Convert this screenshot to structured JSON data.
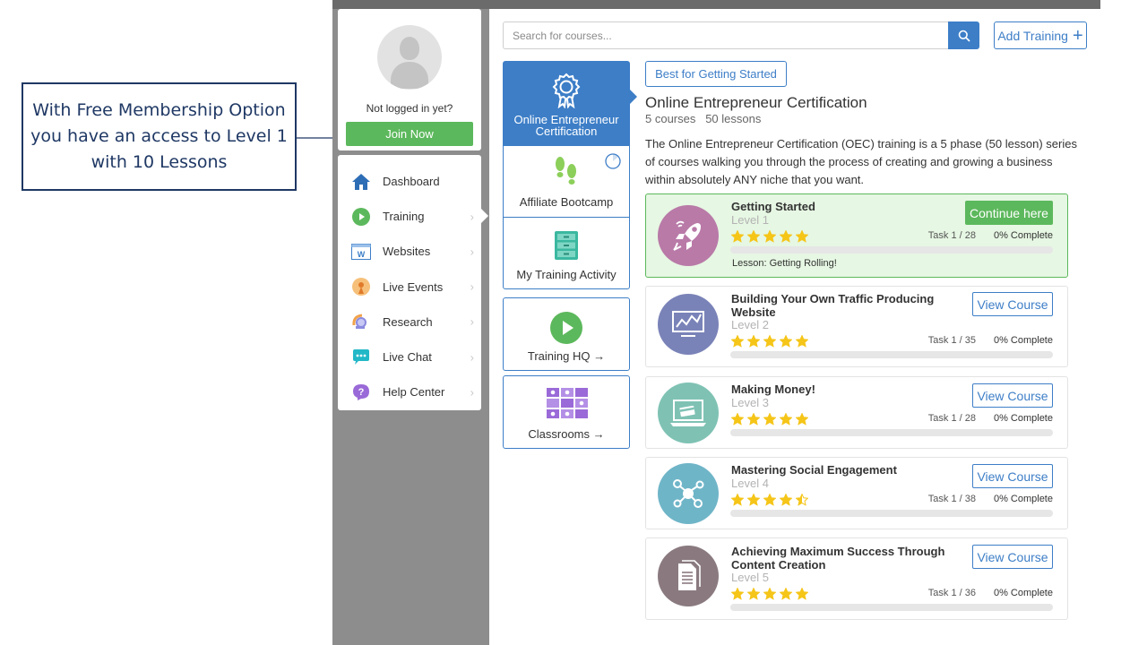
{
  "callout": {
    "text": "With Free Membership Option you have an access to Level 1 with 10 Lessons"
  },
  "sidebar": {
    "login_text": "Not logged in yet?",
    "join_label": "Join Now",
    "items": [
      {
        "label": "Dashboard",
        "icon": "home-icon",
        "color": "#2d6db5"
      },
      {
        "label": "Training",
        "icon": "play-circle-icon",
        "color": "#5cb85c"
      },
      {
        "label": "Websites",
        "icon": "website-icon",
        "color": "#3d7ec7"
      },
      {
        "label": "Live Events",
        "icon": "live-events-icon",
        "color": "#f0a24a"
      },
      {
        "label": "Research",
        "icon": "research-icon",
        "color": "#8a8ae0"
      },
      {
        "label": "Live Chat",
        "icon": "chat-icon",
        "color": "#23b8c8"
      },
      {
        "label": "Help Center",
        "icon": "help-icon",
        "color": "#9a6ad8"
      }
    ]
  },
  "search": {
    "placeholder": "Search for courses..."
  },
  "add_training": {
    "label": "Add Training"
  },
  "categories": [
    {
      "label": "Online Entrepreneur Certification",
      "icon": "certificate-icon"
    },
    {
      "label": "Affiliate Bootcamp",
      "icon": "footprints-icon"
    },
    {
      "label": "My Training Activity",
      "icon": "cabinet-icon"
    }
  ],
  "boxes": [
    {
      "label": "Training HQ →",
      "icon": "play-circle-icon"
    },
    {
      "label": "Classrooms →",
      "icon": "classrooms-icon"
    }
  ],
  "program": {
    "badge": "Best for Getting Started",
    "title": "Online Entrepreneur Certification",
    "meta": "5 courses   50 lessons",
    "description": "The Online Entrepreneur Certification (OEC) training is a 5 phase (50 lesson) series of courses walking you through the process of creating and growing a business within absolutely ANY niche that you want."
  },
  "courses": [
    {
      "title": "Getting Started",
      "level": "Level 1",
      "task": "Task 1 / 28",
      "percent": "0% Complete",
      "progress": 0,
      "rating": 5,
      "button": "Continue here",
      "lesson": "Lesson: Getting Rolling!",
      "icon": "rocket-icon",
      "color": "#b97aa8"
    },
    {
      "title": "Building Your Own Traffic Producing Website",
      "level": "Level 2",
      "task": "Task 1 / 35",
      "percent": "0% Complete",
      "progress": 0,
      "rating": 5,
      "button": "View Course",
      "icon": "chart-monitor-icon",
      "color": "#7a83b8"
    },
    {
      "title": "Making Money!",
      "level": "Level 3",
      "task": "Task 1 / 28",
      "percent": "0% Complete",
      "progress": 0,
      "rating": 5,
      "button": "View Course",
      "icon": "laptop-card-icon",
      "color": "#7fc2b4"
    },
    {
      "title": "Mastering Social Engagement",
      "level": "Level 4",
      "task": "Task 1 / 38",
      "percent": "0% Complete",
      "progress": 0,
      "rating": 4.5,
      "button": "View Course",
      "icon": "social-network-icon",
      "color": "#6fb5c8"
    },
    {
      "title": "Achieving Maximum Success Through Content Creation",
      "level": "Level 5",
      "task": "Task 1 / 36",
      "percent": "0% Complete",
      "progress": 0,
      "rating": 5,
      "button": "View Course",
      "icon": "document-icon",
      "color": "#8a7a80"
    }
  ]
}
